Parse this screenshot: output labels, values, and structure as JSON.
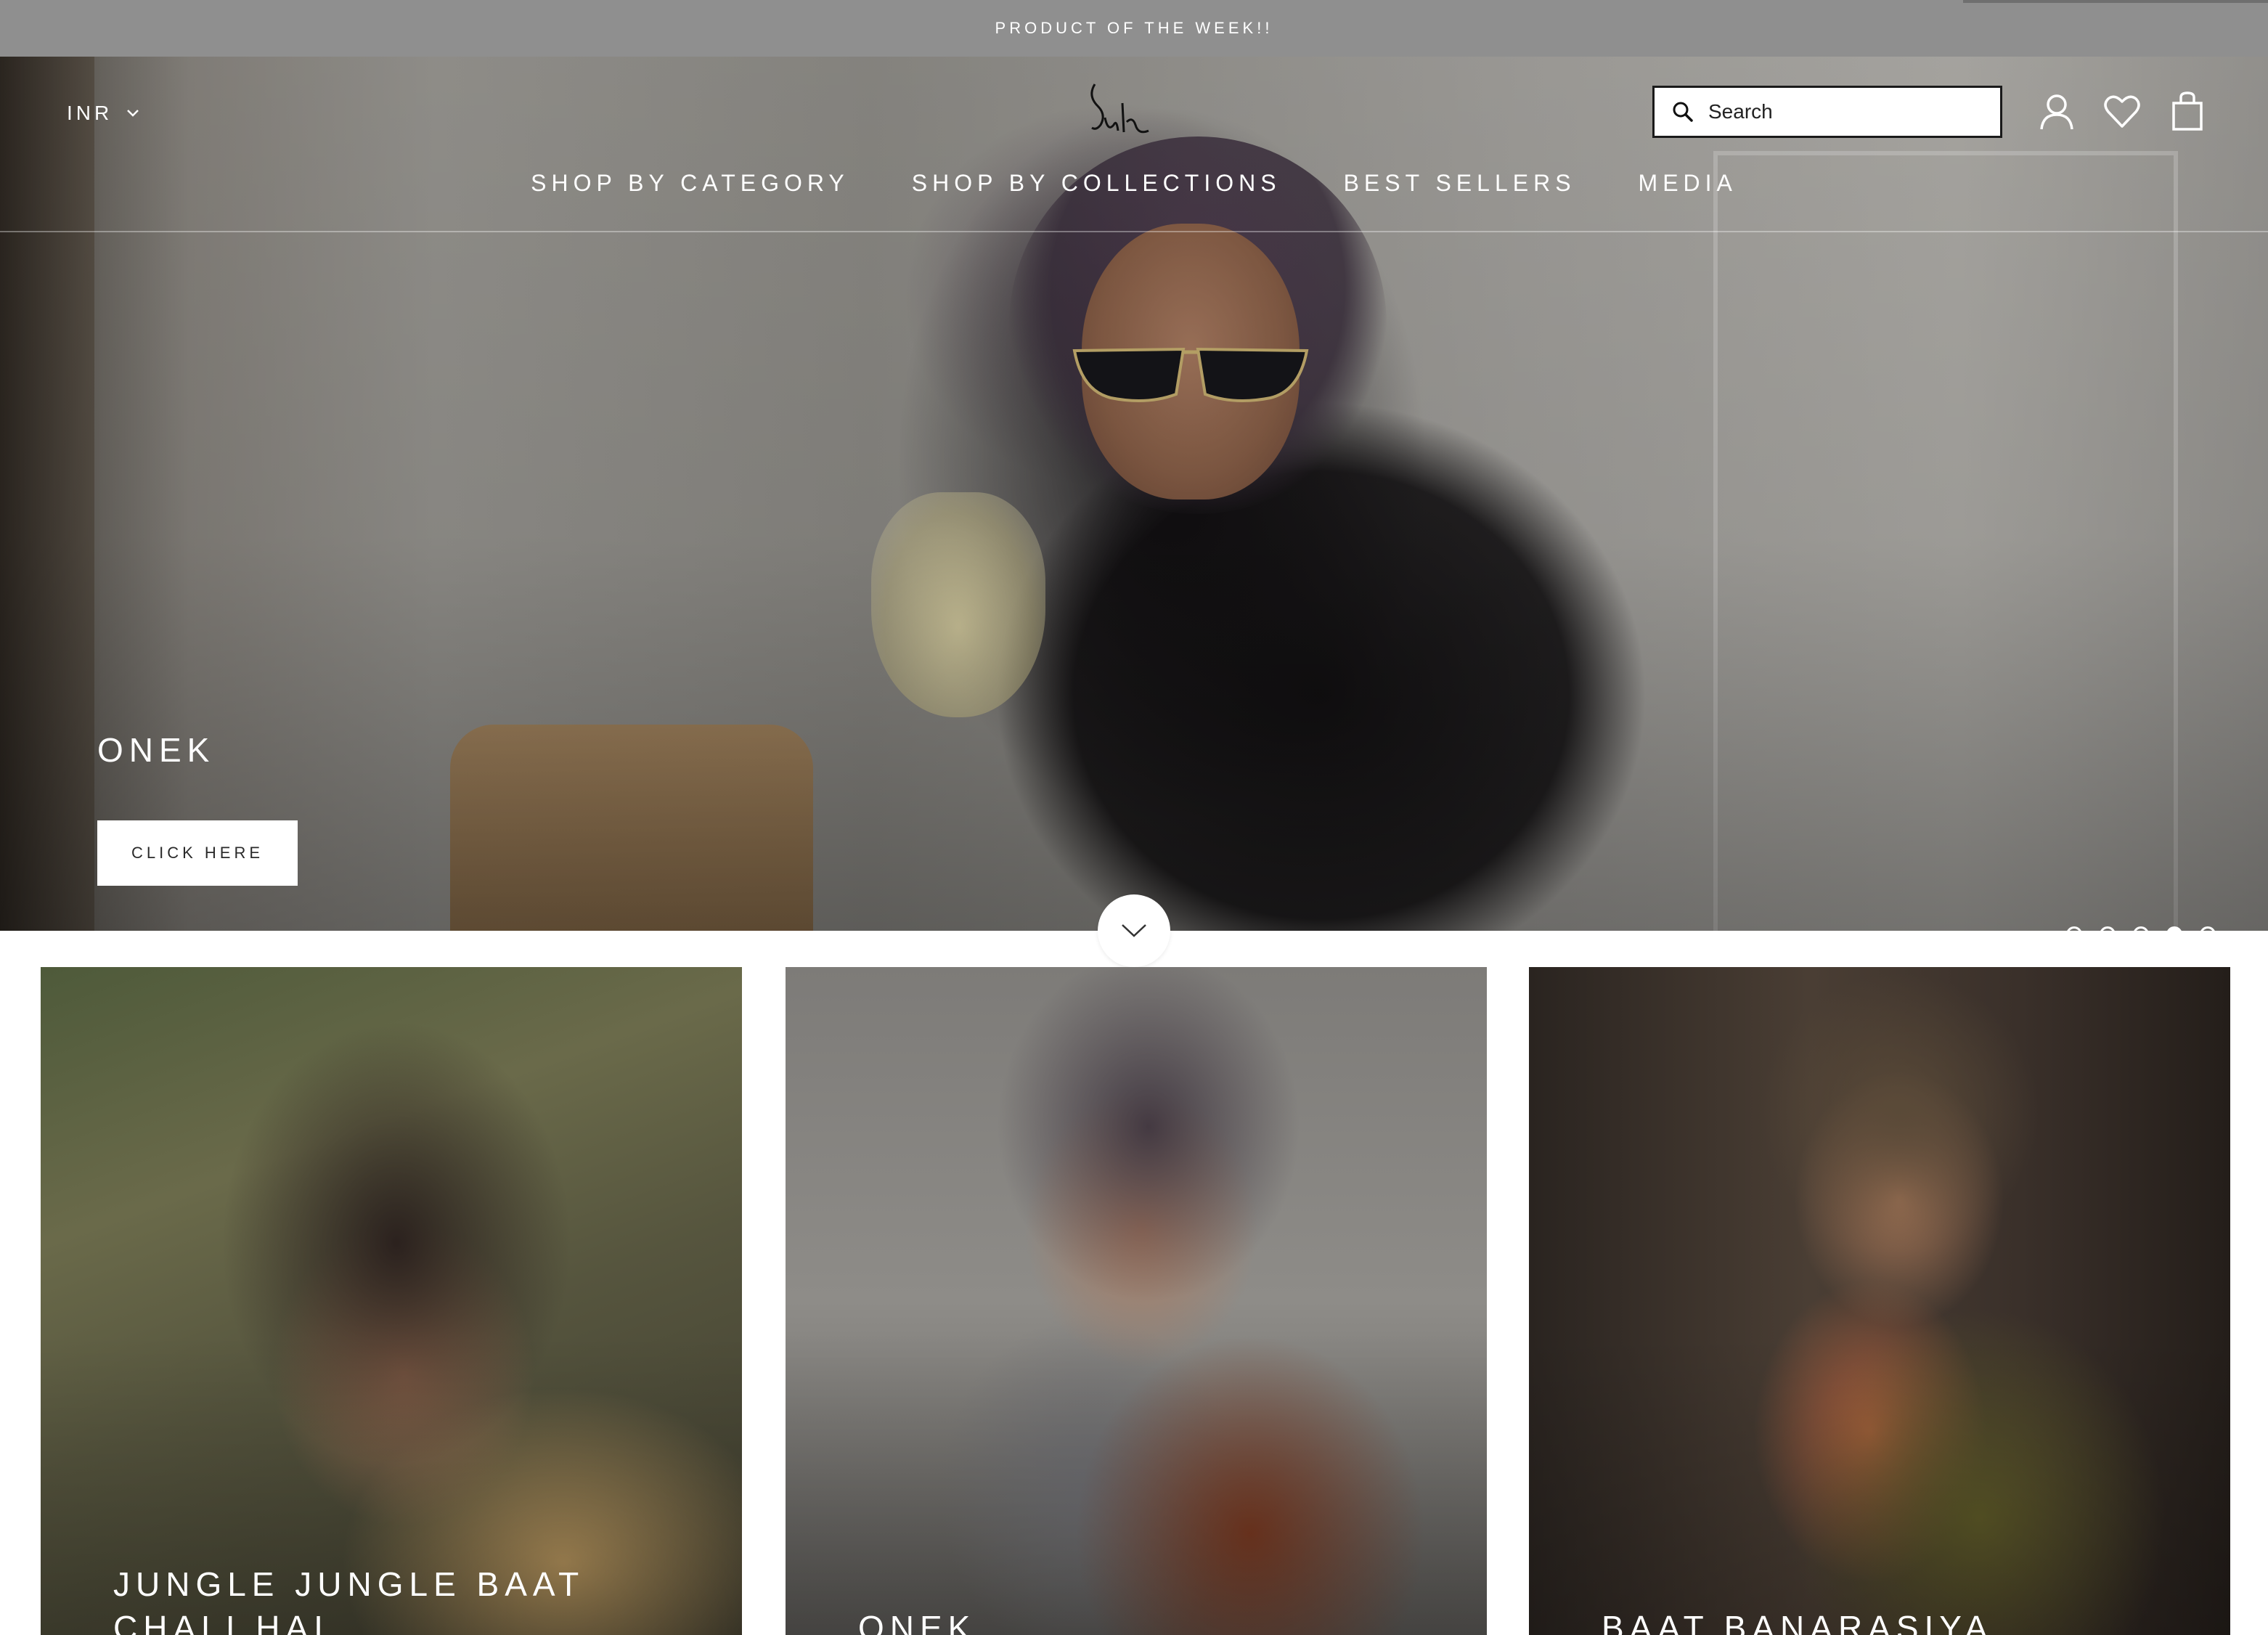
{
  "announcement": {
    "text": "PRODUCT OF THE WEEK!!"
  },
  "header": {
    "currency": "INR",
    "search_placeholder": "Search",
    "nav": [
      {
        "label": "SHOP BY CATEGORY"
      },
      {
        "label": "SHOP BY COLLECTIONS"
      },
      {
        "label": "BEST SELLERS"
      },
      {
        "label": "MEDIA"
      }
    ],
    "icons": [
      "search-icon",
      "account-icon",
      "wishlist-heart-icon",
      "cart-bag-icon",
      "chevron-down-icon"
    ]
  },
  "hero": {
    "title": "ONEK",
    "button_label": "CLICK HERE",
    "slide_count": 5,
    "active_slide": 4
  },
  "collections": [
    {
      "title": "JUNGLE JUNGLE BAAT CHALI HAI"
    },
    {
      "title": "ONEK"
    },
    {
      "title": "BAAT BANARASIYA"
    }
  ],
  "colors": {
    "announcement_bg": "#8f8f8f",
    "text_on_image": "#ffffff",
    "button_bg": "#ffffff"
  }
}
